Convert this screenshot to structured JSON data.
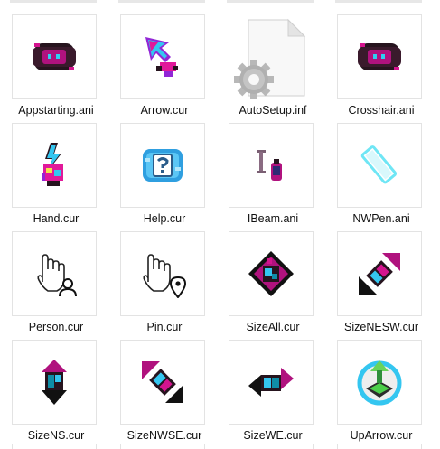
{
  "files": [
    {
      "name": "Appstarting.ani",
      "icon": "appstarting-cursor-icon"
    },
    {
      "name": "Arrow.cur",
      "icon": "arrow-cursor-icon"
    },
    {
      "name": "AutoSetup.inf",
      "icon": "setup-information-file-icon"
    },
    {
      "name": "Crosshair.ani",
      "icon": "crosshair-cursor-icon"
    },
    {
      "name": "Hand.cur",
      "icon": "hand-cursor-icon"
    },
    {
      "name": "Help.cur",
      "icon": "help-cursor-icon"
    },
    {
      "name": "IBeam.ani",
      "icon": "ibeam-cursor-icon"
    },
    {
      "name": "NWPen.ani",
      "icon": "pen-cursor-icon"
    },
    {
      "name": "Person.cur",
      "icon": "person-cursor-icon"
    },
    {
      "name": "Pin.cur",
      "icon": "pin-cursor-icon"
    },
    {
      "name": "SizeAll.cur",
      "icon": "size-all-cursor-icon"
    },
    {
      "name": "SizeNESW.cur",
      "icon": "size-nesw-cursor-icon"
    },
    {
      "name": "SizeNS.cur",
      "icon": "size-ns-cursor-icon"
    },
    {
      "name": "SizeNWSE.cur",
      "icon": "size-nwse-cursor-icon"
    },
    {
      "name": "SizeWE.cur",
      "icon": "size-we-cursor-icon"
    },
    {
      "name": "UpArrow.cur",
      "icon": "up-arrow-cursor-icon"
    }
  ],
  "colors": {
    "magenta": "#d4148f",
    "cyan": "#34c6f0",
    "dark": "#26141e",
    "teal": "#0f8da6",
    "black": "#111111"
  }
}
